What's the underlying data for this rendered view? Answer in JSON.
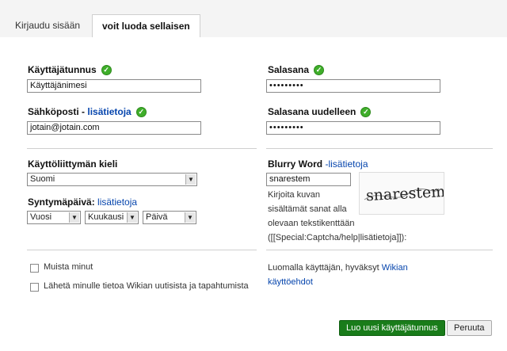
{
  "tabs": [
    {
      "label": "Kirjaudu sisään"
    },
    {
      "label": "voit luoda sellaisen"
    }
  ],
  "form": {
    "username": {
      "label": "Käyttäjätunnus",
      "value": "Käyttäjänimesi"
    },
    "email": {
      "label": "Sähköposti -",
      "link": "lisätietoja",
      "value": "jotain@jotain.com"
    },
    "password": {
      "label": "Salasana",
      "value": "•••••••••"
    },
    "password_again": {
      "label": "Salasana uudelleen",
      "value": "•••••••••"
    },
    "language": {
      "label": "Käyttöliittymän kieli",
      "value": "Suomi"
    },
    "birthday": {
      "label": "Syntymäpäivä:",
      "link": "lisätietoja",
      "year": "Vuosi",
      "month": "Kuukausi",
      "day": "Päivä"
    },
    "captcha": {
      "label": "Blurry Word",
      "link": "-lisätietoja",
      "value": "snarestem",
      "image_text": "snarestem",
      "help_lines": [
        "Kirjoita kuvan",
        "sisältämät sanat alla",
        "olevaan tekstikenttään",
        "([[Special:Captcha/help|lisätietoja]]):"
      ]
    },
    "remember": {
      "label": "Muista minut"
    },
    "newsletter": {
      "label": "Lähetä minulle tietoa Wikian uutisista ja tapahtumista"
    },
    "terms": {
      "text": "Luomalla käyttäjän, hyväksyt",
      "link1": "Wikian",
      "link2": "käyttöehdot"
    },
    "submit_label": "Luo uusi käyttäjätunnus",
    "cancel_label": "Peruuta",
    "ok_mark": "✓",
    "accent_color": "#197c1a",
    "link_color": "#0645ad"
  }
}
